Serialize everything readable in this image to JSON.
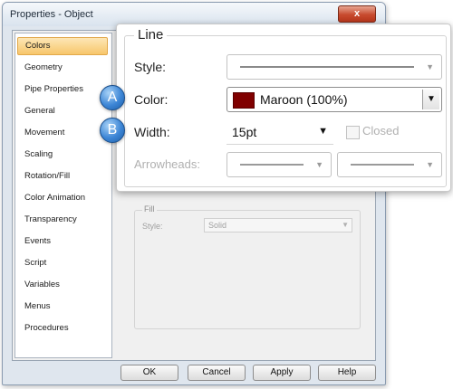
{
  "window": {
    "title": "Properties - Object",
    "close_label": "x"
  },
  "sidebar": {
    "items": [
      {
        "label": "Colors",
        "selected": true
      },
      {
        "label": "Geometry"
      },
      {
        "label": "Pipe Properties"
      },
      {
        "label": "General"
      },
      {
        "label": "Movement"
      },
      {
        "label": "Scaling"
      },
      {
        "label": "Rotation/Fill"
      },
      {
        "label": "Color Animation"
      },
      {
        "label": "Transparency"
      },
      {
        "label": "Events"
      },
      {
        "label": "Script"
      },
      {
        "label": "Variables"
      },
      {
        "label": "Menus"
      },
      {
        "label": "Procedures"
      }
    ]
  },
  "fill": {
    "legend": "Fill",
    "style_label": "Style:",
    "style_value": "Solid"
  },
  "line": {
    "legend": "Line",
    "style_label": "Style:",
    "color_label": "Color:",
    "color_value": "Maroon (100%)",
    "color_hex": "#800000",
    "width_label": "Width:",
    "width_value": "15pt",
    "closed_label": "Closed",
    "arrowheads_label": "Arrowheads:"
  },
  "badges": {
    "a": "A",
    "b": "B"
  },
  "buttons": {
    "ok": "OK",
    "cancel": "Cancel",
    "apply": "Apply",
    "help": "Help"
  }
}
